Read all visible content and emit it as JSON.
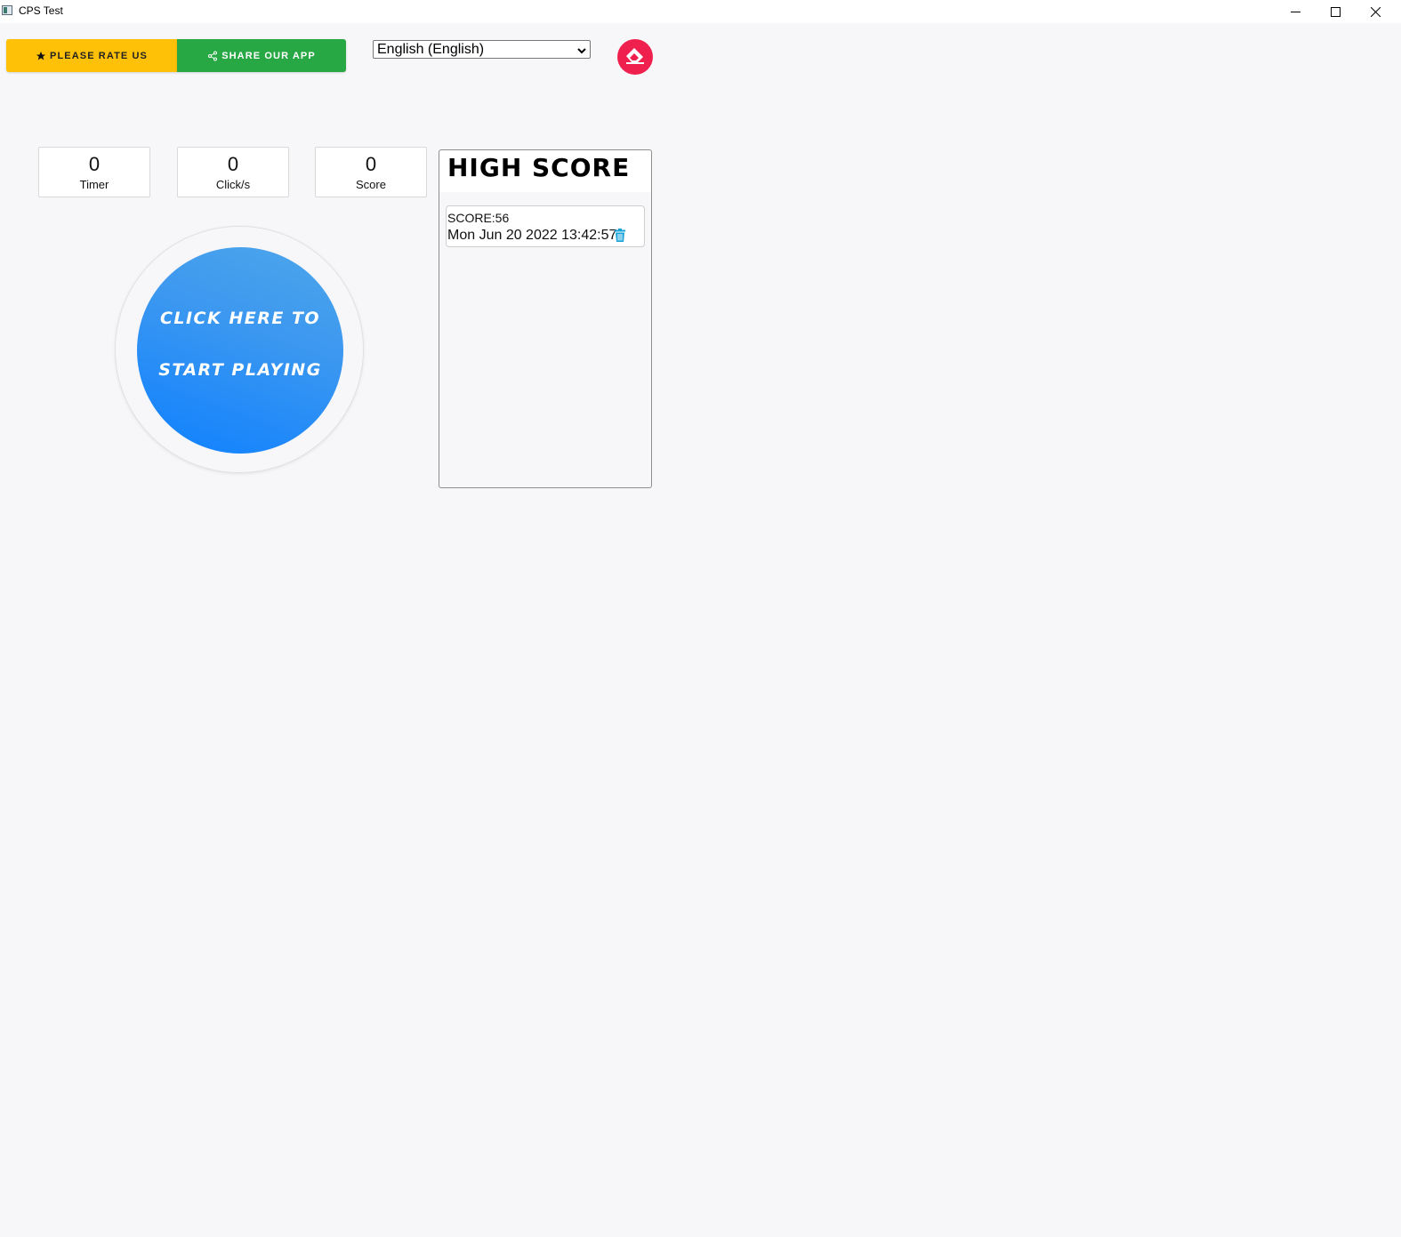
{
  "window": {
    "title": "CPS Test"
  },
  "toolbar": {
    "rate_label": "PLEASE RATE US",
    "share_label": "SHARE OUR APP",
    "language": "English (English)"
  },
  "stats": {
    "timer": {
      "value": "0",
      "label": "Timer"
    },
    "clicks": {
      "value": "0",
      "label": "Click/s"
    },
    "score": {
      "value": "0",
      "label": "Score"
    }
  },
  "play_button": {
    "line1": "Click here to",
    "line2": "start playing"
  },
  "high_score": {
    "title": "HiGH SCORE",
    "entries": [
      {
        "score": "SCORE:56",
        "date": "Mon Jun 20 2022 13:42:57"
      }
    ]
  },
  "colors": {
    "rate": "#ffc107",
    "share": "#28a745",
    "eraser": "#f0204e",
    "play": "#1683fb",
    "trash": "#17a2d8"
  }
}
